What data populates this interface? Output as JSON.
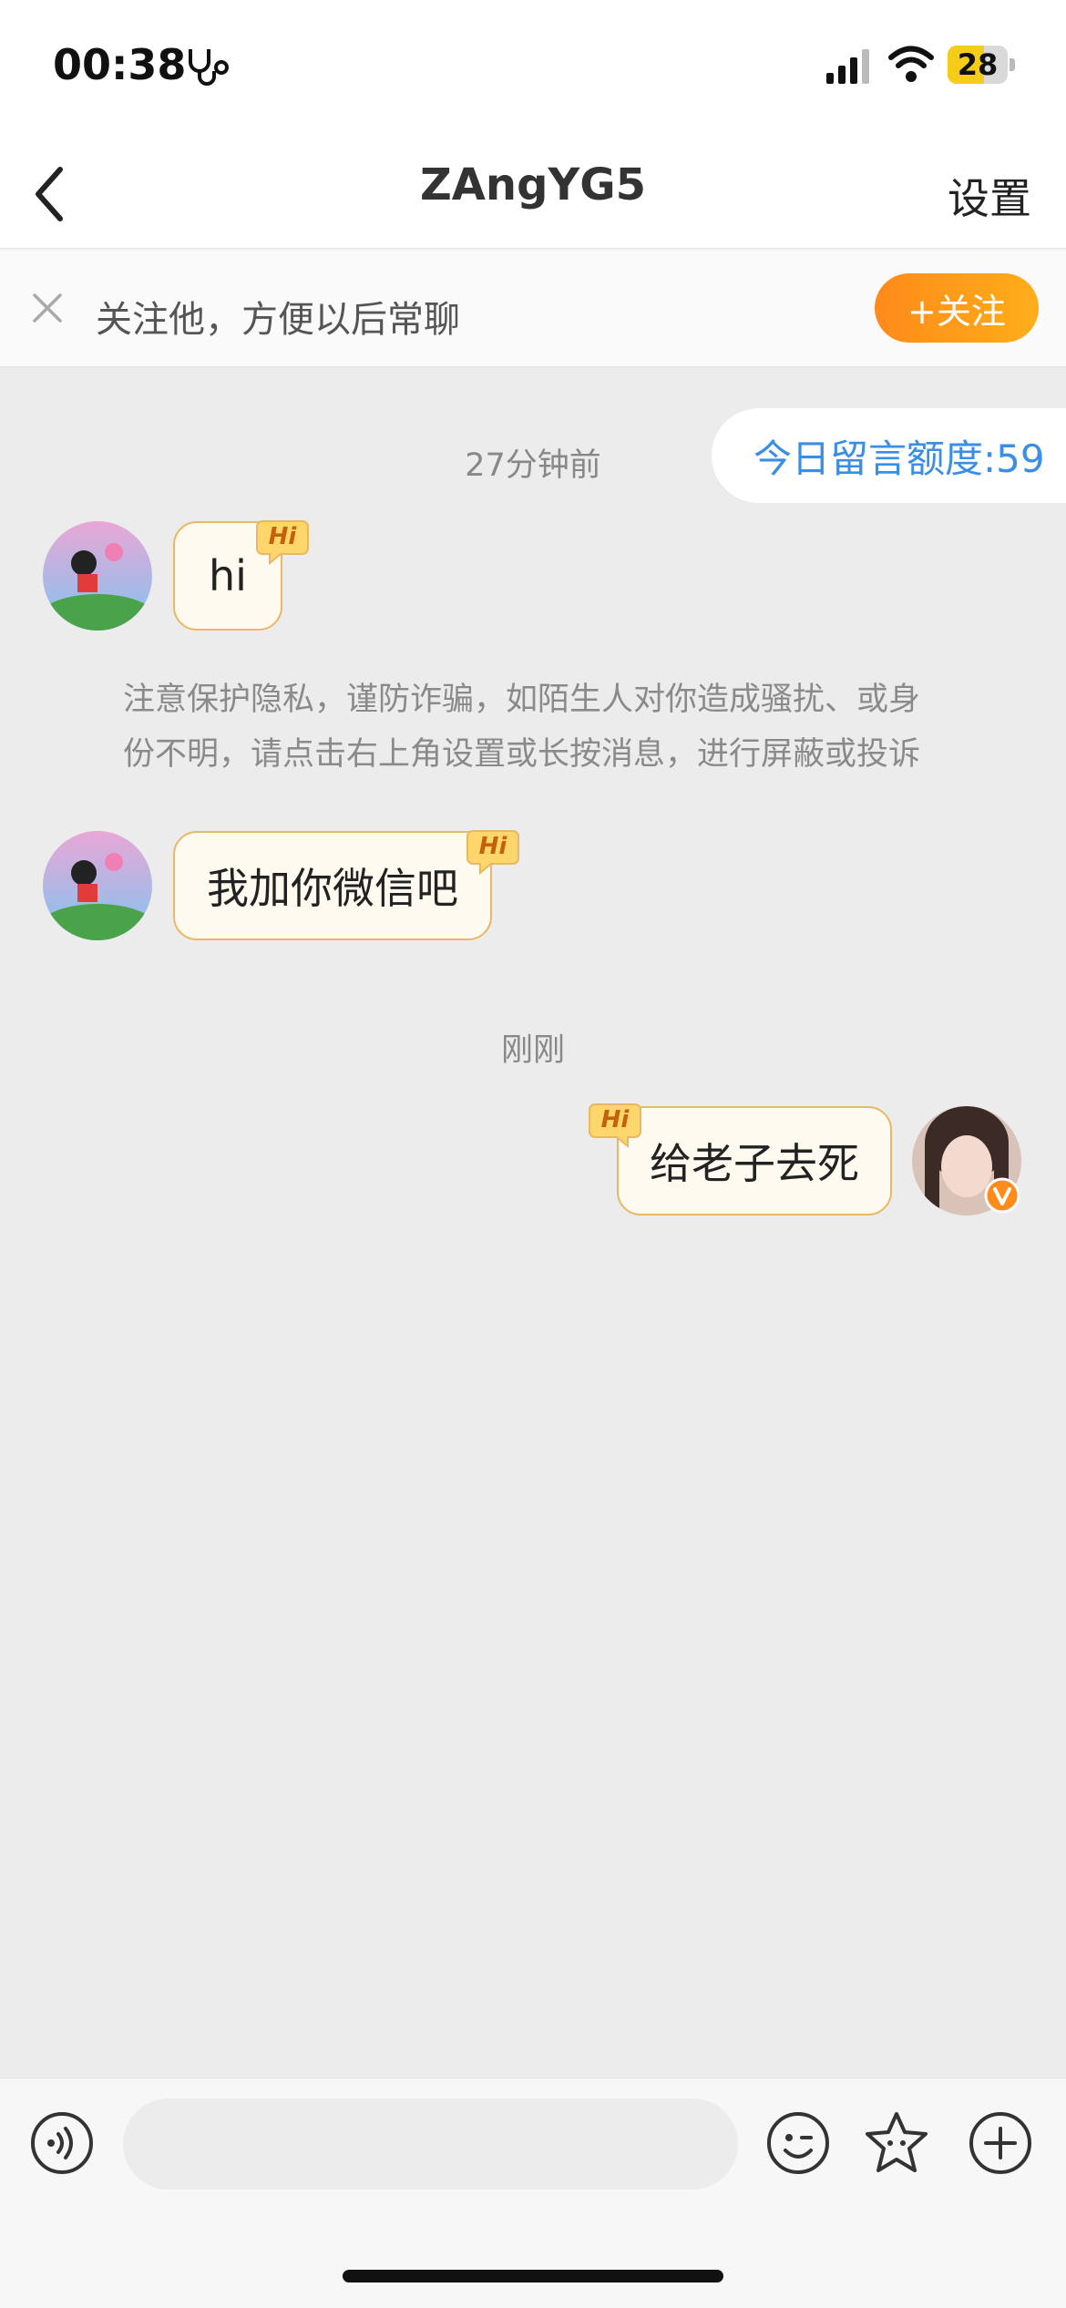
{
  "status_bar": {
    "time": "00:38",
    "battery": "28"
  },
  "nav": {
    "title": "ZAngYG5",
    "settings_label": "设置"
  },
  "follow_bar": {
    "text": "关注他，方便以后常聊",
    "button_label": "+关注"
  },
  "quota": {
    "text": "今日留言额度:59"
  },
  "messages": [
    {
      "time": "27分钟前"
    },
    {
      "from": "them",
      "text": "hi",
      "badge": "Hi"
    },
    {
      "notice_line1": "注意保护隐私，谨防诈骗，如陌生人对你造成骚扰、或身",
      "notice_line2": "份不明，请点击右上角设置或长按消息，进行屏蔽或投诉"
    },
    {
      "from": "them",
      "text": "我加你微信吧",
      "badge": "Hi"
    },
    {
      "time": "刚刚"
    },
    {
      "from": "me",
      "text": "给老子去死",
      "badge": "Hi"
    }
  ],
  "colors": {
    "accent_orange": "#ff9a1a",
    "quota_blue": "#3a8ee6",
    "bubble_border": "#e9b865"
  },
  "icons": [
    "stethoscope-icon",
    "signal-icon",
    "wifi-icon",
    "battery-icon",
    "back-icon",
    "close-icon",
    "voice-icon",
    "emoji-icon",
    "sticker-icon",
    "plus-icon",
    "hi-badge-icon",
    "verified-icon"
  ]
}
